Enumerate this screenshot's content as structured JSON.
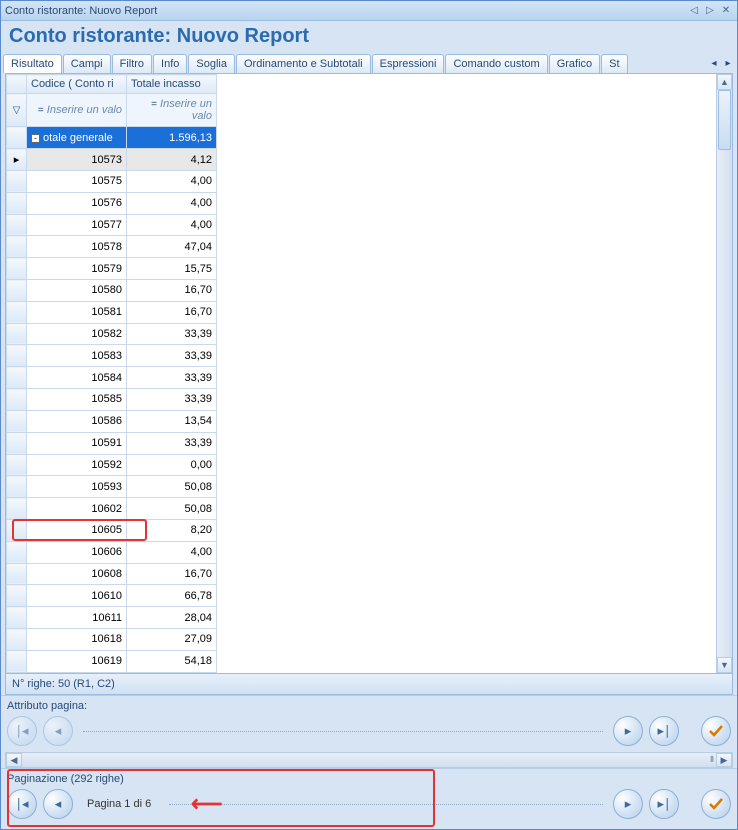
{
  "window": {
    "title": "Conto ristorante: Nuovo Report"
  },
  "header": {
    "title": "Conto ristorante: Nuovo Report"
  },
  "tabs": {
    "items": [
      {
        "label": "Risultato",
        "active": true
      },
      {
        "label": "Campi"
      },
      {
        "label": "Filtro"
      },
      {
        "label": "Info"
      },
      {
        "label": "Soglia"
      },
      {
        "label": "Ordinamento e Subtotali"
      },
      {
        "label": "Espressioni"
      },
      {
        "label": "Comando custom"
      },
      {
        "label": "Grafico"
      },
      {
        "label": "St"
      }
    ]
  },
  "grid": {
    "columns": {
      "code": "Codice ( Conto ri",
      "total": "Totale incasso"
    },
    "filter_placeholder": "Inserire un valo",
    "total_row": {
      "label": "otale generale",
      "value": "1.596,13"
    },
    "rows": [
      {
        "code": "10573",
        "value": "4,12",
        "selected": true
      },
      {
        "code": "10575",
        "value": "4,00"
      },
      {
        "code": "10576",
        "value": "4,00"
      },
      {
        "code": "10577",
        "value": "4,00"
      },
      {
        "code": "10578",
        "value": "47,04"
      },
      {
        "code": "10579",
        "value": "15,75"
      },
      {
        "code": "10580",
        "value": "16,70"
      },
      {
        "code": "10581",
        "value": "16,70"
      },
      {
        "code": "10582",
        "value": "33,39"
      },
      {
        "code": "10583",
        "value": "33,39"
      },
      {
        "code": "10584",
        "value": "33,39"
      },
      {
        "code": "10585",
        "value": "33,39"
      },
      {
        "code": "10586",
        "value": "13,54"
      },
      {
        "code": "10591",
        "value": "33,39"
      },
      {
        "code": "10592",
        "value": "0,00"
      },
      {
        "code": "10593",
        "value": "50,08"
      },
      {
        "code": "10602",
        "value": "50,08"
      },
      {
        "code": "10605",
        "value": "8,20"
      },
      {
        "code": "10606",
        "value": "4,00"
      },
      {
        "code": "10608",
        "value": "16,70"
      },
      {
        "code": "10610",
        "value": "66,78"
      },
      {
        "code": "10611",
        "value": "28,04"
      },
      {
        "code": "10618",
        "value": "27,09"
      },
      {
        "code": "10619",
        "value": "54,18"
      }
    ]
  },
  "status": {
    "text": "N° righe: 50  (R1, C2)"
  },
  "attr": {
    "label": "Attributo pagina:"
  },
  "pagination": {
    "label": "Paginazione (292 righe)",
    "page_text": "Pagina 1 di 6"
  }
}
